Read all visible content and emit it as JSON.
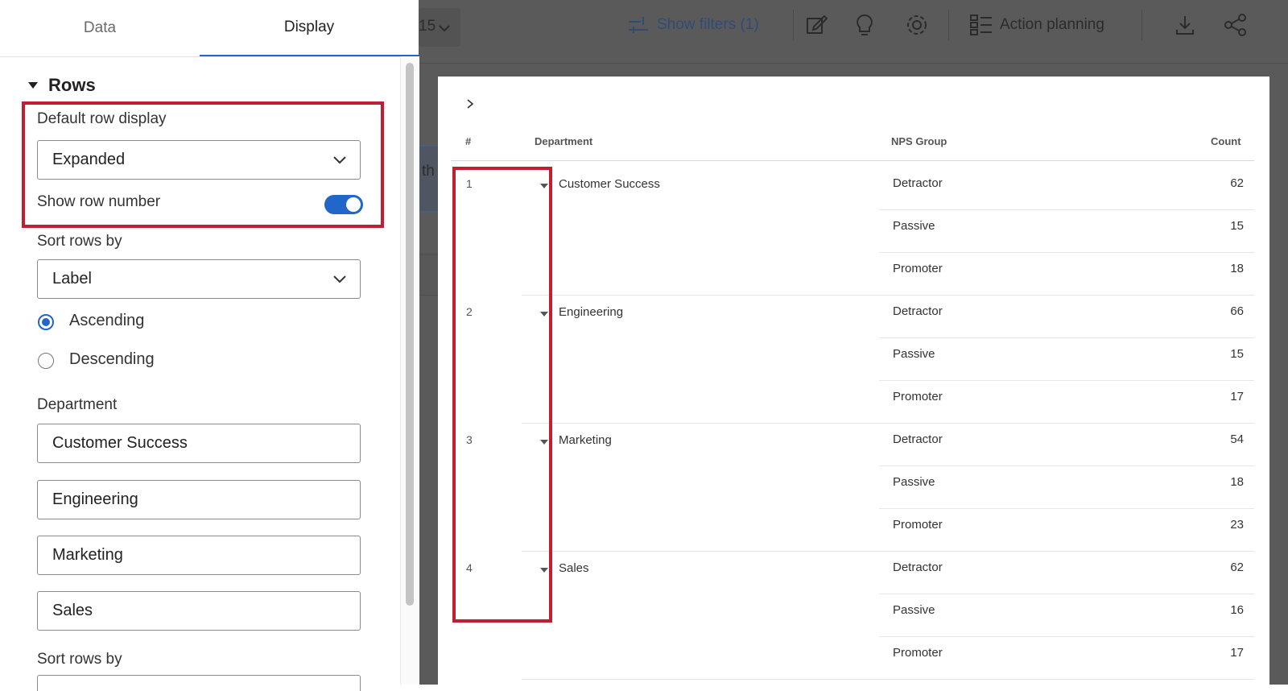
{
  "panel": {
    "tabs": [
      "Data",
      "Display"
    ],
    "section_title": "Rows",
    "default_row_display_label": "Default row display",
    "default_row_display_value": "Expanded",
    "show_row_number_label": "Show row number",
    "show_row_number_on": true,
    "sort_rows_by_label": "Sort rows by",
    "sort_rows_by_value": "Label",
    "order_options": [
      "Ascending",
      "Descending"
    ],
    "order_selected": "Ascending",
    "department_label": "Department",
    "department_values": [
      "Customer Success",
      "Engineering",
      "Marketing",
      "Sales"
    ],
    "sort_rows_by_label_2": "Sort rows by"
  },
  "toolbar": {
    "date_fragment": "15",
    "show_filters": "Show filters (1)",
    "action_planning": "Action planning"
  },
  "background_fragment": "th",
  "table": {
    "headers": {
      "num": "#",
      "department": "Department",
      "nps_group": "NPS Group",
      "count": "Count"
    },
    "groups": [
      {
        "num": "1",
        "department": "Customer Success",
        "rows": [
          {
            "nps": "Detractor",
            "count": "62"
          },
          {
            "nps": "Passive",
            "count": "15"
          },
          {
            "nps": "Promoter",
            "count": "18"
          }
        ]
      },
      {
        "num": "2",
        "department": "Engineering",
        "rows": [
          {
            "nps": "Detractor",
            "count": "66"
          },
          {
            "nps": "Passive",
            "count": "15"
          },
          {
            "nps": "Promoter",
            "count": "17"
          }
        ]
      },
      {
        "num": "3",
        "department": "Marketing",
        "rows": [
          {
            "nps": "Detractor",
            "count": "54"
          },
          {
            "nps": "Passive",
            "count": "18"
          },
          {
            "nps": "Promoter",
            "count": "23"
          }
        ]
      },
      {
        "num": "4",
        "department": "Sales",
        "rows": [
          {
            "nps": "Detractor",
            "count": "62"
          },
          {
            "nps": "Passive",
            "count": "16"
          },
          {
            "nps": "Promoter",
            "count": "17"
          }
        ]
      }
    ]
  },
  "colors": {
    "accent": "#2166c9",
    "highlight": "#c01f32",
    "overlay": "#5a5a5a"
  }
}
